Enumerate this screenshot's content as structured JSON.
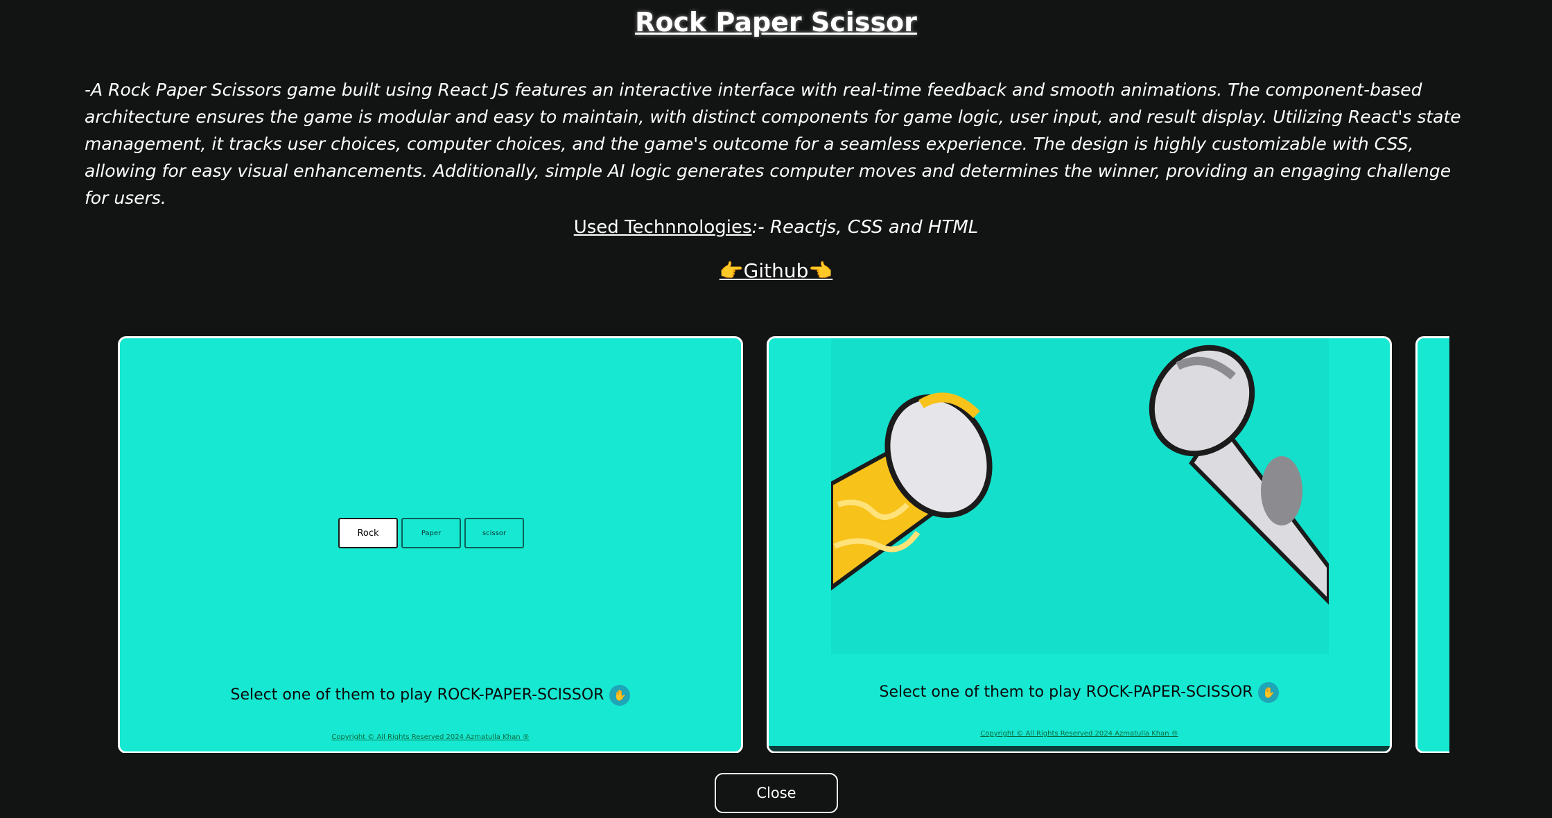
{
  "title": "Rock Paper Scissor",
  "description": "-A Rock Paper Scissors game built using React JS features an interactive interface with real-time feedback and smooth animations. The component-based architecture ensures the game is modular and easy to maintain, with distinct components for game logic, user input, and result display. Utilizing React's state management, it tracks user choices, computer choices, and the game's outcome for a seamless experience. The design is highly customizable with CSS, allowing for easy visual enhancements. Additionally, simple AI logic generates computer moves and determines the winner, providing an engaging challenge for users.",
  "tech": {
    "label": "Used Technnologies",
    "value": ":- Reactjs, CSS and HTML"
  },
  "github": {
    "label": "👉Github👈"
  },
  "slides": [
    {
      "buttons": [
        "Rock",
        "Paper",
        "scissor"
      ],
      "select_text": "Select one of them to play ROCK-PAPER-SCISSOR",
      "copyright": "Copyright © All Rights Reserved 2024 Azmatulla Khan ®"
    },
    {
      "select_text": "Select one of them to play ROCK-PAPER-SCISSOR",
      "copyright": "Copyright © All Rights Reserved 2024 Azmatulla Khan ®"
    }
  ],
  "close_label": "Close",
  "colors": {
    "background": "#121313",
    "card": "#17e8d2",
    "accent": "#ffffff"
  },
  "icons": {
    "hand": "raised-hand-icon"
  }
}
